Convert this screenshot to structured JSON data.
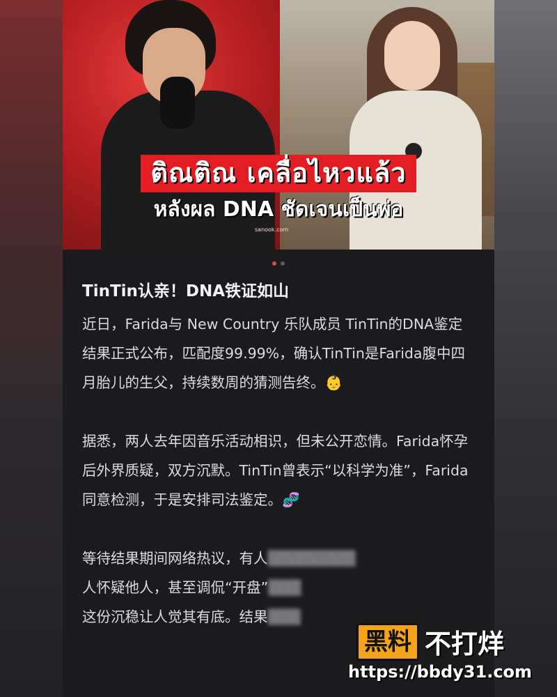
{
  "hero": {
    "headline_line1": "ติณติณ เคลื่อไหวแล้ว",
    "headline_line2": "หลังผล DNA ชัดเจนเป็นพ่อ",
    "source": "sanook.com"
  },
  "carousel": {
    "total": 2,
    "active_index": 0,
    "active_color": "#e04a4a",
    "inactive_color": "#5c5c60"
  },
  "post": {
    "title": "TinTin认亲！DNA铁证如山",
    "paragraphs": [
      "近日，Farida与 New Country 乐队成员 TinTin的DNA鉴定结果正式公布，匹配度99.99%，确认TinTin是Farida腹中四月胎儿的生父，持续数周的猜测告终。👶",
      "据悉，两人去年因音乐活动相识，但未公开恋情。Farida怀孕后外界质疑，双方沉默。TinTin曾表示“以科学为准”，Farida同意检测，于是安排司法鉴定。🧬"
    ],
    "last_para_line1": "等待结果期间网络热议，有人",
    "last_para_line2": "人怀疑他人，甚至调侃“开盘”",
    "last_para_line3": "这份沉稳让人觉其有底。结果"
  },
  "watermark": {
    "logo": "黑料",
    "text": "不打烊",
    "url": "https://bbdy31.com"
  }
}
